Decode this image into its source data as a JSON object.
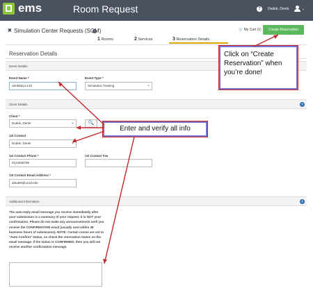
{
  "header": {
    "logo_text": "ems",
    "title": "Room Request",
    "user_name": "Dudek, Derek",
    "help_glyph": "?",
    "caret": "⌄"
  },
  "request": {
    "title": "Simulation Center Requests (SOM)",
    "cart_label": "My Cart (1)",
    "create_label": "Create Reservation"
  },
  "steps": [
    {
      "num": "1",
      "label": "Rooms"
    },
    {
      "num": "2",
      "label": "Services"
    },
    {
      "num": "3",
      "label": "Reservation Details"
    }
  ],
  "reservation": {
    "section_title": "Reservation Details",
    "event_details_header": "Event Details",
    "event_name_label": "Event Name *",
    "event_name_value": "SimManLL133",
    "event_type_label": "Event Type *",
    "event_type_value": "Simulation Training",
    "client_details_header": "Client Details",
    "client_label": "Client *",
    "client_value": "Dudek, Derek",
    "first_contact_label": "1st Contact",
    "first_contact_value": "Dudek, Derek",
    "phone_label": "1st Contact Phone *",
    "phone_value": "0123456789",
    "fax_label": "1st Contact Fax",
    "email_label": "1st Contact Email Address *",
    "email_value": "ddudek@ucsd.edu",
    "additional_header": "Additional Information",
    "auto_message": "The auto-reply email message you receive immediately after your submission is a summary of your request; it is NOT your confirmation. Please do not make any announcements until you receive the CONFIRMATION email (usually sent within 48 business hours of submission). NOTE: Certain rooms are set to \"Auto Confirm\" status, so check the reservation status on the email message. If the status is CONFIRMED, then you will not receive another confirmation message."
  },
  "annotations": {
    "create_callout": "Click on “Create Reservation” when you’re done!",
    "verify_callout": "Enter and verify all info"
  },
  "icons": {
    "logo": "ems-logo-icon",
    "help": "help-icon",
    "user": "user-icon",
    "close": "close-icon",
    "info": "info-icon",
    "cart": "cart-icon",
    "search": "search-icon"
  },
  "colors": {
    "header_bg": "#4a5260",
    "accent_green": "#5cb85c",
    "logo_green": "#8cc63f",
    "step_underline": "#d9a400",
    "callout_border": "#7b6fd1",
    "arrow": "#c0282a"
  }
}
